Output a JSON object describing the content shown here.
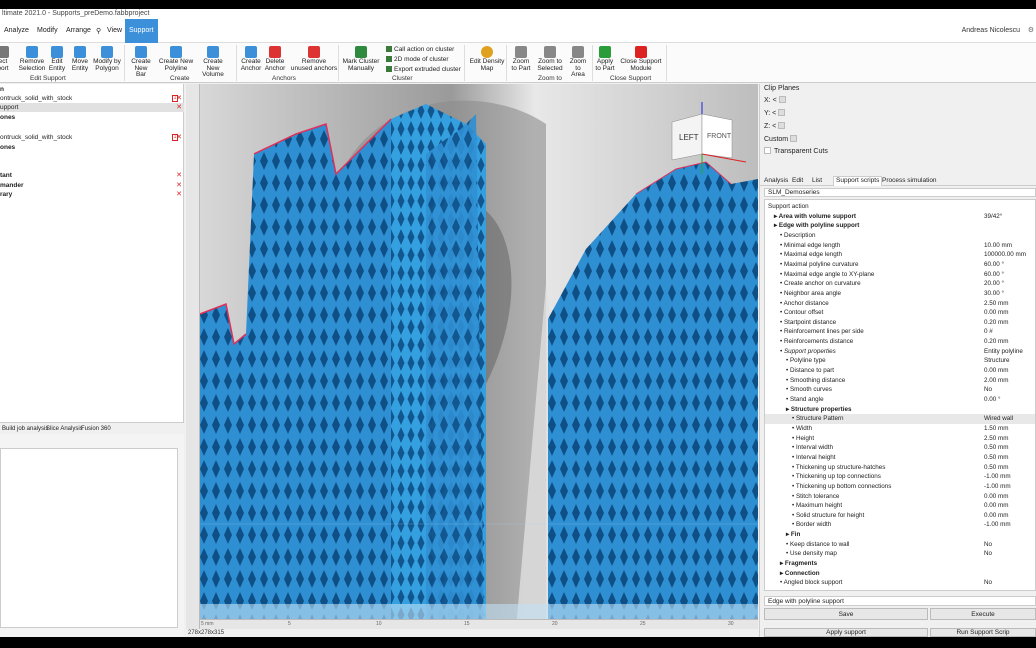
{
  "title": "ltimate 2021.0 - Supports_preDemo.fabbproject",
  "menu": [
    "Analyze",
    "Modify",
    "Arrange",
    "View",
    "Support"
  ],
  "user": "Andreas Nicolescu",
  "ribbon": {
    "buttons": [
      "ect\nport",
      "Remove\nSelection",
      "Edit\nEntity",
      "Move\nEntity",
      "Modify by\nPolygon",
      "Create\nNew Bar",
      "Create New\nPolyline",
      "Create New\nVolume",
      "Create\nAnchor",
      "Delete\nAnchor",
      "Remove\nunused anchors",
      "Mark Cluster\nManually",
      "Edit Density\nMap",
      "Zoom\nto Part",
      "Zoom to\nSelected",
      "Zoom\nto Area",
      "Apply\nto Part",
      "Close Support\nModule"
    ],
    "cluster_items": [
      "Call action on cluster",
      "2D mode of cluster",
      "Export extruded cluster"
    ],
    "groups": [
      "Edit Support",
      "Create",
      "Anchors",
      "Cluster",
      "Zoom to",
      "Close Support"
    ]
  },
  "tree": [
    {
      "label": "n",
      "x": false
    },
    {
      "label": "ontruck_solid_with_stock",
      "x": true,
      "badge": "1"
    },
    {
      "label": "upport",
      "x": true,
      "selected": true
    },
    {
      "label": "ones",
      "x": false
    },
    {
      "label": "",
      "x": false
    },
    {
      "label": "ontruck_solid_with_stock",
      "x": true,
      "badge": "1"
    },
    {
      "label": "ones",
      "x": false
    },
    {
      "label": "",
      "x": false
    },
    {
      "label": "",
      "x": false
    },
    {
      "label": "tant",
      "x": true
    },
    {
      "label": "mander",
      "x": true
    },
    {
      "label": "rary",
      "x": true
    }
  ],
  "left_tabs": [
    "Build job analysis",
    "Slice Analysis",
    "Fusion 360"
  ],
  "viewcube": {
    "left": "LEFT",
    "front": "FRONT"
  },
  "viewport_status": "278x278x315",
  "ruler_ticks": [
    "5 mm",
    "5",
    "10",
    "15",
    "20",
    "25",
    "30"
  ],
  "clip": {
    "title": "Clip Planes",
    "x": "X:",
    "y": "Y:",
    "z": "Z:",
    "custom": "Custom",
    "transparent": "Transparent Cuts"
  },
  "right_tabs": [
    "Analysis",
    "Edit",
    "List",
    "Support scripts",
    "Process simulation"
  ],
  "preset": "SLM_Demoseries",
  "props": [
    {
      "k": "Support action",
      "v": "",
      "i": 0
    },
    {
      "k": "Area with volume support",
      "v": "39/42°",
      "i": 1,
      "bold": true
    },
    {
      "k": "Edge with polyline support",
      "v": "",
      "i": 1,
      "bold": true
    },
    {
      "k": "Description",
      "v": "",
      "i": 2
    },
    {
      "k": "Minimal edge length",
      "v": "10.00 mm",
      "i": 2
    },
    {
      "k": "Maximal edge length",
      "v": "100000.00 mm",
      "i": 2
    },
    {
      "k": "Maximal polyline curvature",
      "v": "60.00 °",
      "i": 2
    },
    {
      "k": "Maximal edge angle to XY-plane",
      "v": "60.00 °",
      "i": 2
    },
    {
      "k": "Create anchor on curvature",
      "v": "20.00 °",
      "i": 2
    },
    {
      "k": "Neighbor area angle",
      "v": "30.00 °",
      "i": 2
    },
    {
      "k": "Anchor distance",
      "v": "2.50 mm",
      "i": 2
    },
    {
      "k": "Contour offset",
      "v": "0.00 mm",
      "i": 2
    },
    {
      "k": "Startpoint distance",
      "v": "0.20 mm",
      "i": 2
    },
    {
      "k": "Reinforcement lines per side",
      "v": "0 #",
      "i": 2
    },
    {
      "k": "Reinforcements distance",
      "v": "0.20 mm",
      "i": 2
    },
    {
      "k": "Support properties",
      "v": "Entity polyline",
      "i": 2,
      "ital": true
    },
    {
      "k": "Polyline type",
      "v": "Structure",
      "i": 3
    },
    {
      "k": "Distance to part",
      "v": "0.00 mm",
      "i": 3
    },
    {
      "k": "Smoothing distance",
      "v": "2.00 mm",
      "i": 3
    },
    {
      "k": "Smooth curves",
      "v": "No",
      "i": 3
    },
    {
      "k": "Stand angle",
      "v": "0.00 °",
      "i": 3
    },
    {
      "k": "Structure properties",
      "v": "",
      "i": 3,
      "bold": true
    },
    {
      "k": "Structure Pattern",
      "v": "Wired wall",
      "i": 4,
      "hl": true
    },
    {
      "k": "Width",
      "v": "1.50 mm",
      "i": 4
    },
    {
      "k": "Height",
      "v": "2.50 mm",
      "i": 4
    },
    {
      "k": "Interval width",
      "v": "0.50 mm",
      "i": 4
    },
    {
      "k": "Interval height",
      "v": "0.50 mm",
      "i": 4
    },
    {
      "k": "Thickening up structure-hatches",
      "v": "0.50 mm",
      "i": 4
    },
    {
      "k": "Thickening up top connections",
      "v": "-1.00 mm",
      "i": 4
    },
    {
      "k": "Thickening up bottom connections",
      "v": "-1.00 mm",
      "i": 4
    },
    {
      "k": "Stitch tolerance",
      "v": "0.00 mm",
      "i": 4
    },
    {
      "k": "Maximum height",
      "v": "0.00 mm",
      "i": 4
    },
    {
      "k": "Solid structure for height",
      "v": "0.00 mm",
      "i": 4
    },
    {
      "k": "Border width",
      "v": "-1.00 mm",
      "i": 4
    },
    {
      "k": "Fin",
      "v": "",
      "i": 3,
      "bold": true
    },
    {
      "k": "Keep distance to wall",
      "v": "No",
      "i": 3
    },
    {
      "k": "Use density map",
      "v": "No",
      "i": 3
    },
    {
      "k": "Fragments",
      "v": "",
      "i": 2,
      "bold": true
    },
    {
      "k": "Connection",
      "v": "",
      "i": 2,
      "bold": true
    },
    {
      "k": "Angled block support",
      "v": "No",
      "i": 2
    }
  ],
  "bottom_select": "Edge with polyline support",
  "buttons": {
    "save": "Save",
    "execute": "Execute",
    "apply": "Apply support",
    "run": "Run Support Scrip"
  }
}
